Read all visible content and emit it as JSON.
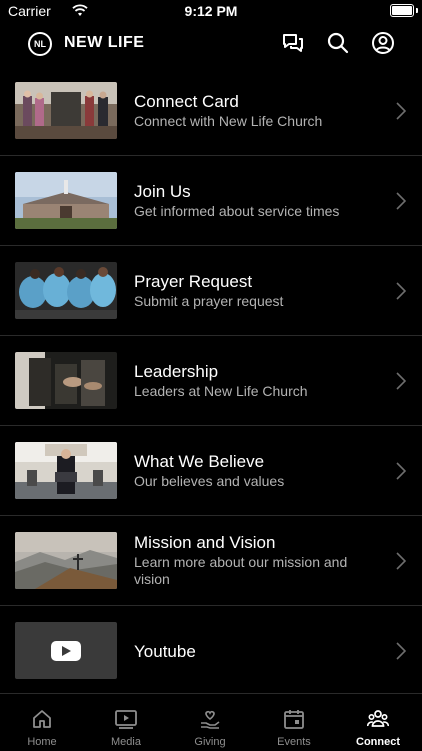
{
  "status_bar": {
    "carrier": "Carrier",
    "time": "9:12 PM"
  },
  "header": {
    "logo_text": "NL",
    "brand": "NEW LIFE",
    "icons": [
      "chat-icon",
      "search-icon",
      "profile-icon"
    ]
  },
  "list": [
    {
      "title": "Connect Card",
      "subtitle": "Connect with New Life Church",
      "thumb": "connect-card-thumbnail"
    },
    {
      "title": "Join Us",
      "subtitle": "Get informed about service times",
      "thumb": "join-us-thumbnail"
    },
    {
      "title": "Prayer Request",
      "subtitle": "Submit a prayer request",
      "thumb": "prayer-request-thumbnail"
    },
    {
      "title": "Leadership",
      "subtitle": "Leaders at New Life Church",
      "thumb": "leadership-thumbnail"
    },
    {
      "title": "What We Believe",
      "subtitle": "Our believes and values",
      "thumb": "what-we-believe-thumbnail"
    },
    {
      "title": "Mission and Vision",
      "subtitle": "Learn more about our mission and vision",
      "thumb": "mission-vision-thumbnail"
    },
    {
      "title": "Youtube",
      "subtitle": "",
      "thumb": "youtube-icon"
    }
  ],
  "tabs": [
    {
      "label": "Home",
      "icon": "home-icon"
    },
    {
      "label": "Media",
      "icon": "media-icon"
    },
    {
      "label": "Giving",
      "icon": "giving-icon"
    },
    {
      "label": "Events",
      "icon": "events-icon"
    },
    {
      "label": "Connect",
      "icon": "connect-icon",
      "active": true
    }
  ],
  "colors": {
    "background": "#000000",
    "text": "#ffffff",
    "subtext": "#b3b3b3",
    "inactive_tab": "#8e8e8e"
  }
}
